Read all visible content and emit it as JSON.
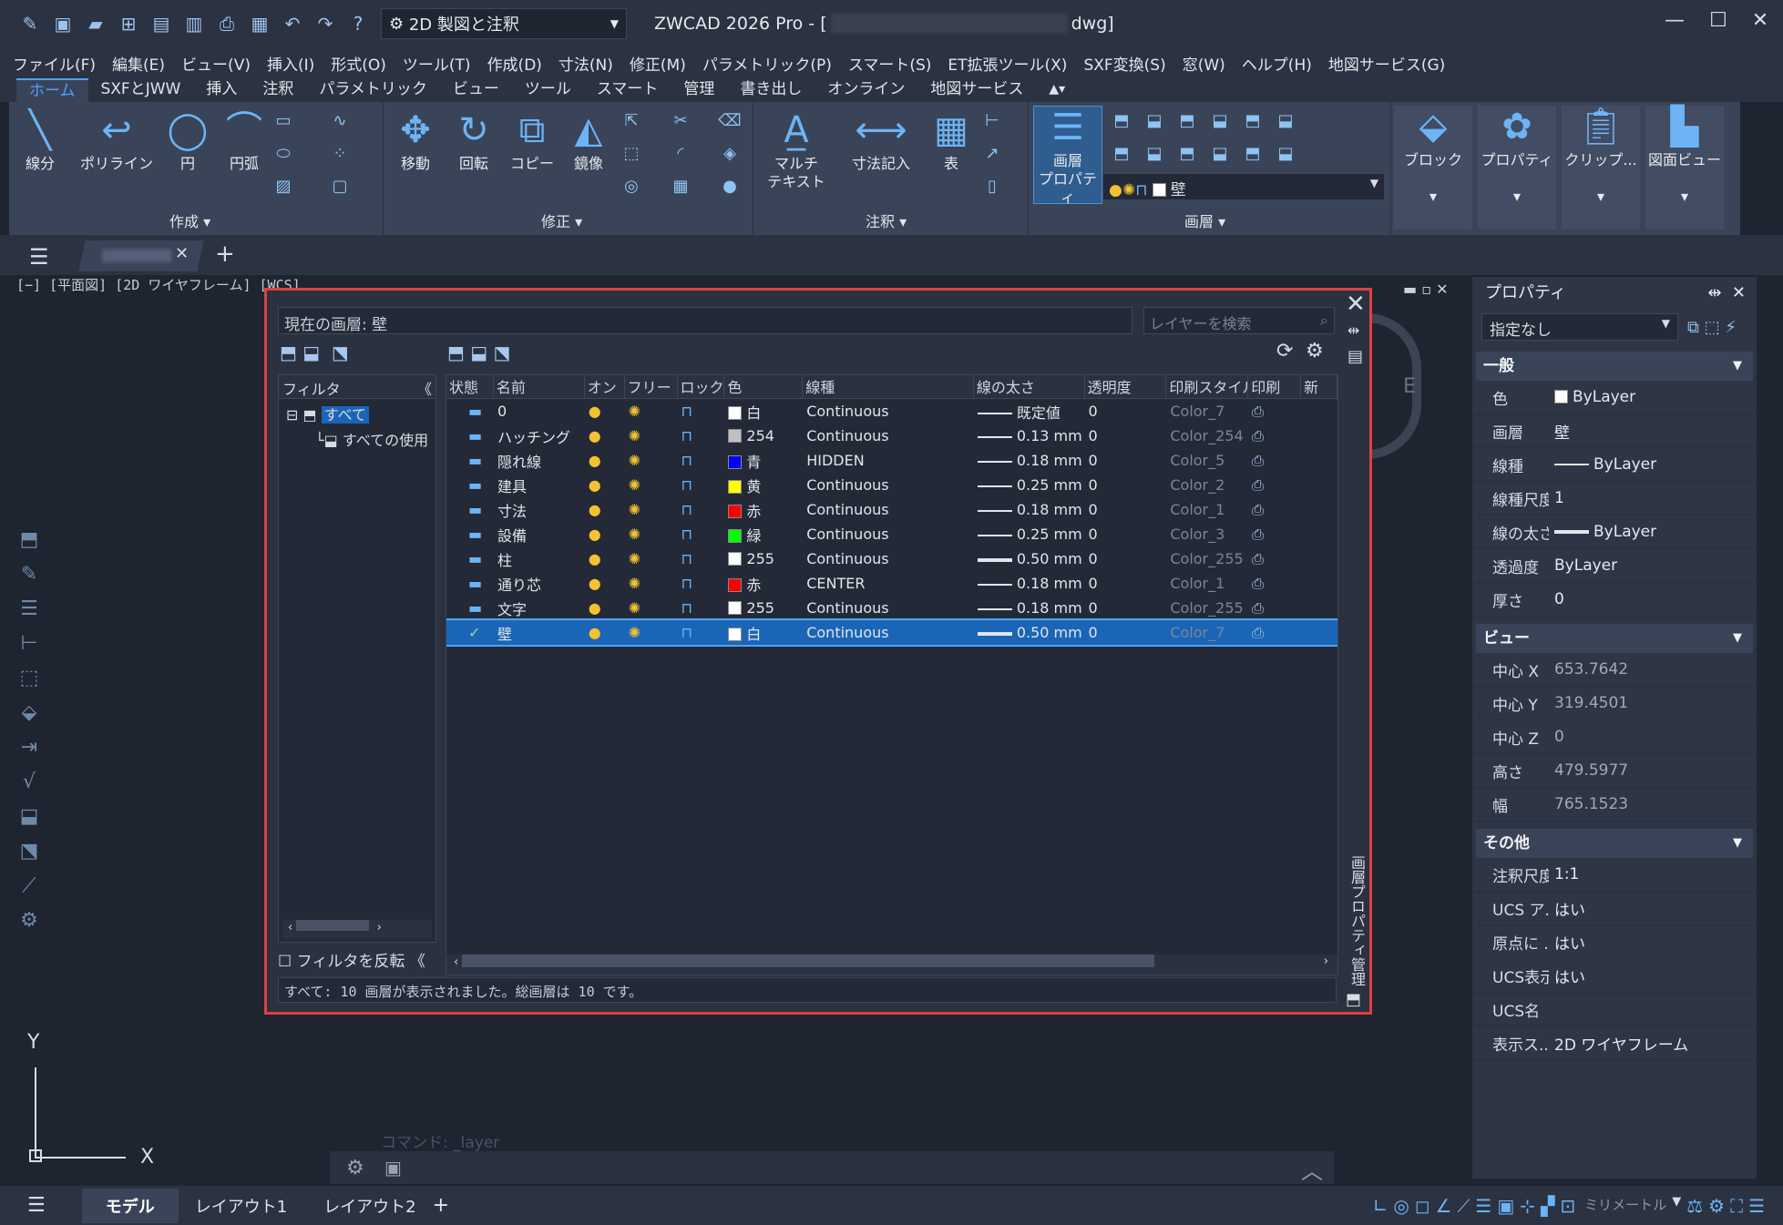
{
  "titlebar": {
    "workspace": "2D 製図と注釈",
    "app_title_prefix": "ZWCAD 2026 Pro - [",
    "app_title_suffix": "dwg]"
  },
  "menu": [
    "ファイル(F)",
    "編集(E)",
    "ビュー(V)",
    "挿入(I)",
    "形式(O)",
    "ツール(T)",
    "作成(D)",
    "寸法(N)",
    "修正(M)",
    "パラメトリック(P)",
    "スマート(S)",
    "ET拡張ツール(X)",
    "SXF変換(S)",
    "窓(W)",
    "ヘルプ(H)",
    "地図サービス(G)"
  ],
  "ribbon_tabs": [
    "ホーム",
    "SXFとJWW",
    "挿入",
    "注釈",
    "パラメトリック",
    "ビュー",
    "ツール",
    "スマート",
    "管理",
    "書き出し",
    "オンライン",
    "地図サービス"
  ],
  "ribbon": {
    "line": "線分",
    "polyline": "ポリライン",
    "circle": "円",
    "arc": "円弧",
    "create_group": "作成",
    "move": "移動",
    "rotate": "回転",
    "copy": "コピー",
    "mirror": "鏡像",
    "modify_group": "修正",
    "mtext1": "マルチ",
    "mtext2": "テキスト",
    "dim": "寸法記入",
    "table": "表",
    "annot_group": "注釈",
    "layerprops1": "画層",
    "layerprops2": "プロパティ",
    "layer_current": "壁",
    "layer_group": "画層",
    "block": "ブロック",
    "properties": "プロパティ",
    "clipboard": "クリップ...",
    "drawview": "図面ビュー"
  },
  "view_label": "[−] [平面図] [2D ワイヤフレーム] [WCS]",
  "layer_panel": {
    "current_layer": "現在の画層: 壁",
    "search_placeholder": "レイヤーを検索",
    "filter_header": "フィルタ",
    "filter_all": "すべて",
    "filter_used": "すべての使用",
    "invert_filter": "フィルタを反転",
    "columns": [
      "状態",
      "名前",
      "オン",
      "フリー",
      "ロック",
      "色",
      "線種",
      "線の太さ",
      "透明度",
      "印刷スタイル",
      "印刷",
      "新"
    ],
    "rows": [
      {
        "name": "0",
        "color_hex": "#ffffff",
        "color": "白",
        "linetype": "Continuous",
        "lineweight": "既定値",
        "transparency": "0",
        "style": "Color_7",
        "thick": false
      },
      {
        "name": "ハッチング",
        "color_hex": "#c0c0c0",
        "color": "254",
        "linetype": "Continuous",
        "lineweight": "0.13 mm",
        "transparency": "0",
        "style": "Color_254",
        "thick": false
      },
      {
        "name": "隠れ線",
        "color_hex": "#0000ff",
        "color": "青",
        "linetype": "HIDDEN",
        "lineweight": "0.18 mm",
        "transparency": "0",
        "style": "Color_5",
        "thick": false
      },
      {
        "name": "建具",
        "color_hex": "#ffff00",
        "color": "黄",
        "linetype": "Continuous",
        "lineweight": "0.25 mm",
        "transparency": "0",
        "style": "Color_2",
        "thick": false
      },
      {
        "name": "寸法",
        "color_hex": "#ff0000",
        "color": "赤",
        "linetype": "Continuous",
        "lineweight": "0.18 mm",
        "transparency": "0",
        "style": "Color_1",
        "thick": false
      },
      {
        "name": "設備",
        "color_hex": "#00ff00",
        "color": "緑",
        "linetype": "Continuous",
        "lineweight": "0.25 mm",
        "transparency": "0",
        "style": "Color_3",
        "thick": false
      },
      {
        "name": "柱",
        "color_hex": "#ffffff",
        "color": "255",
        "linetype": "Continuous",
        "lineweight": "0.50 mm",
        "transparency": "0",
        "style": "Color_255",
        "thick": true
      },
      {
        "name": "通り芯",
        "color_hex": "#ff0000",
        "color": "赤",
        "linetype": "CENTER",
        "lineweight": "0.18 mm",
        "transparency": "0",
        "style": "Color_1",
        "thick": false
      },
      {
        "name": "文字",
        "color_hex": "#ffffff",
        "color": "255",
        "linetype": "Continuous",
        "lineweight": "0.18 mm",
        "transparency": "0",
        "style": "Color_255",
        "thick": false
      },
      {
        "name": "壁",
        "color_hex": "#ffffff",
        "color": "白",
        "linetype": "Continuous",
        "lineweight": "0.50 mm",
        "transparency": "0",
        "style": "Color_7",
        "thick": true,
        "current": true
      }
    ],
    "status": "すべて: 10 画層が表示されました。総画層は 10 です。",
    "side_title": "画層プロパティ管理"
  },
  "properties": {
    "title": "プロパティ",
    "selection": "指定なし",
    "sections": [
      {
        "name": "一般",
        "rows": [
          [
            "色",
            "ByLayer"
          ],
          [
            "画層",
            "壁"
          ],
          [
            "線種",
            "ByLayer"
          ],
          [
            "線種尺度",
            "1"
          ],
          [
            "線の太さ",
            "ByLayer"
          ],
          [
            "透過度",
            "ByLayer"
          ],
          [
            "厚さ",
            "0"
          ]
        ]
      },
      {
        "name": "ビュー",
        "rows": [
          [
            "中心 X",
            "653.7642"
          ],
          [
            "中心 Y",
            "319.4501"
          ],
          [
            "中心 Z",
            "0"
          ],
          [
            "高さ",
            "479.5977"
          ],
          [
            "幅",
            "765.1523"
          ]
        ]
      },
      {
        "name": "その他",
        "rows": [
          [
            "注釈尺度",
            "1:1"
          ],
          [
            "UCS ア...",
            "はい"
          ],
          [
            "原点に ...",
            "はい"
          ],
          [
            "UCS表示",
            "はい"
          ],
          [
            "UCS名",
            ""
          ],
          [
            "表示ス...",
            "2D ワイヤフレーム"
          ]
        ]
      }
    ]
  },
  "command_hint": "コマンド: _layer",
  "layout_tabs": [
    "モデル",
    "レイアウト1",
    "レイアウト2"
  ],
  "units": "ミリメートル",
  "compass": "E",
  "axis_x": "X",
  "axis_y": "Y"
}
